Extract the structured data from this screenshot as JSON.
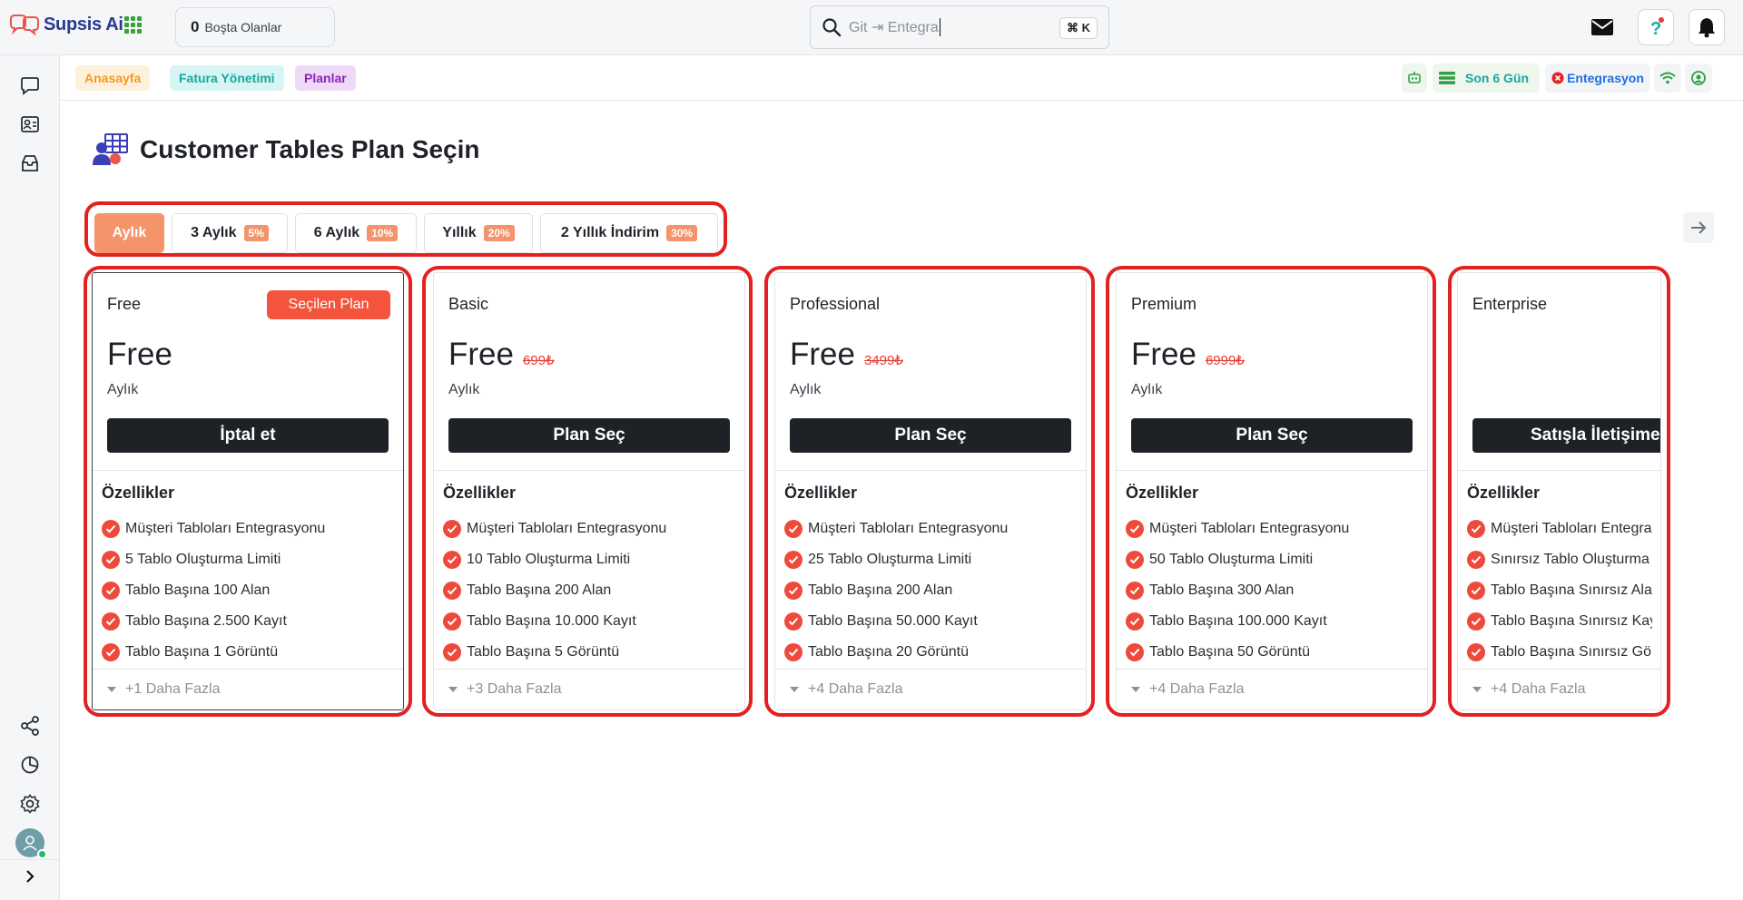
{
  "app": {
    "name": "Supsis Ai"
  },
  "topbar": {
    "idle_count": "0",
    "idle_label": "Boşta Olanlar",
    "search_value": "Git ⇥ Entegra",
    "search_shortcut": "⌘ K"
  },
  "breadcrumbs": [
    "Anasayfa",
    "Fatura Yönetimi",
    "Planlar"
  ],
  "status": {
    "period": "Son 6 Gün",
    "integration": "Entegrasyon"
  },
  "page": {
    "title": "Customer Tables Plan Seçin"
  },
  "billing_periods": [
    {
      "label": "Aylık",
      "discount": "",
      "active": true
    },
    {
      "label": "3 Aylık",
      "discount": "5%"
    },
    {
      "label": "6 Aylık",
      "discount": "10%"
    },
    {
      "label": "Yıllık",
      "discount": "20%"
    },
    {
      "label": "2 Yıllık İndirim",
      "discount": "30%"
    }
  ],
  "plans": [
    {
      "name": "Free",
      "badge": "Seçilen Plan",
      "price": "Free",
      "old_price": "",
      "period": "Aylık",
      "button": "İptal et",
      "features_title": "Özellikler",
      "features": [
        "Müşteri Tabloları Entegrasyonu",
        "5 Tablo Oluşturma Limiti",
        "Tablo Başına 100 Alan",
        "Tablo Başına 2.500 Kayıt",
        "Tablo Başına 1 Görüntü"
      ],
      "more": "+1 Daha Fazla"
    },
    {
      "name": "Basic",
      "badge": "",
      "price": "Free",
      "old_price": "699₺",
      "period": "Aylık",
      "button": "Plan Seç",
      "features_title": "Özellikler",
      "features": [
        "Müşteri Tabloları Entegrasyonu",
        "10 Tablo Oluşturma Limiti",
        "Tablo Başına 200 Alan",
        "Tablo Başına 10.000 Kayıt",
        "Tablo Başına 5 Görüntü"
      ],
      "more": "+3 Daha Fazla"
    },
    {
      "name": "Professional",
      "badge": "",
      "price": "Free",
      "old_price": "3499₺",
      "period": "Aylık",
      "button": "Plan Seç",
      "features_title": "Özellikler",
      "features": [
        "Müşteri Tabloları Entegrasyonu",
        "25 Tablo Oluşturma Limiti",
        "Tablo Başına 200 Alan",
        "Tablo Başına 50.000 Kayıt",
        "Tablo Başına 20 Görüntü"
      ],
      "more": "+4 Daha Fazla"
    },
    {
      "name": "Premium",
      "badge": "",
      "price": "Free",
      "old_price": "6999₺",
      "period": "Aylık",
      "button": "Plan Seç",
      "features_title": "Özellikler",
      "features": [
        "Müşteri Tabloları Entegrasyonu",
        "50 Tablo Oluşturma Limiti",
        "Tablo Başına 300 Alan",
        "Tablo Başına 100.000 Kayıt",
        "Tablo Başına 50 Görüntü"
      ],
      "more": "+4 Daha Fazla"
    },
    {
      "name": "Enterprise",
      "badge": "",
      "price": "",
      "old_price": "",
      "period": "",
      "button": "Satışla İletişime",
      "features_title": "Özellikler",
      "features": [
        "Müşteri Tabloları Entegrasyonu",
        "Sınırsız Tablo Oluşturma",
        "Tablo Başına Sınırsız Alan",
        "Tablo Başına Sınırsız Kayıt",
        "Tablo Başına Sınırsız Görüntü"
      ],
      "more": "+4 Daha Fazla"
    }
  ],
  "colors": {
    "accent": "#f5936a",
    "highlight": "#e32121",
    "brand": "#2b3a8f",
    "check": "#ee4a3c"
  }
}
